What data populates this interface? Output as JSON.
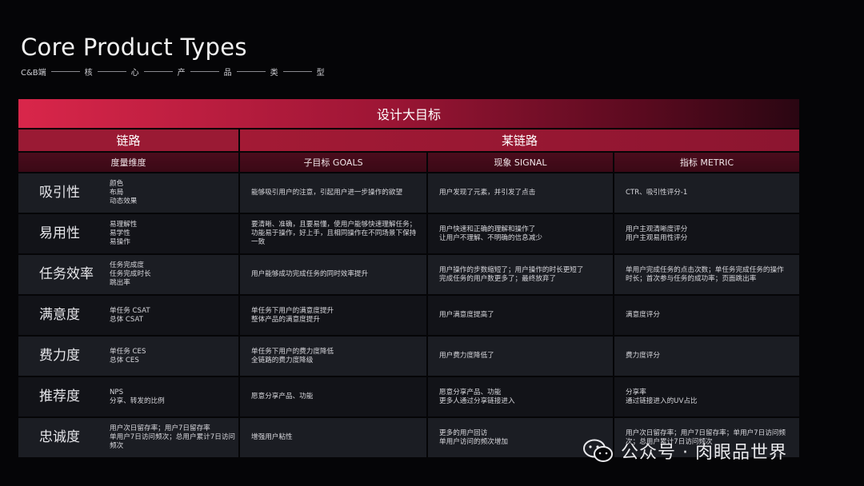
{
  "header": {
    "title": "Core Product Types",
    "subtitle": [
      "C&B端",
      "核",
      "心",
      "产",
      "品",
      "类",
      "型"
    ]
  },
  "table": {
    "banner": "设计大目标",
    "header1": {
      "left": "链路",
      "right": "某链路"
    },
    "header2": [
      "度量维度",
      "子目标 GOALS",
      "现象 SIGNAL",
      "指标 METRIC"
    ],
    "rows": [
      {
        "dimension": "吸引性",
        "subs": [
          "颜色",
          "布局",
          "动态效果"
        ],
        "goals": "能够吸引用户的注意，引起用户进一步操作的欲望",
        "signal": "用户发现了元素，并引发了点击",
        "metric": "CTR、吸引性评分-1"
      },
      {
        "dimension": "易用性",
        "subs": [
          "易理解性",
          "易学性",
          "易操作"
        ],
        "goals": "要清晰、准确，且要易懂，使用户能够快速理解任务；\n功能易于操作，好上手，且相同操作在不同场景下保持一致",
        "signal": "用户快速和正确的理解和操作了\n让用户不理解、不明确的信息减少",
        "metric": "用户主观清晰度评分\n用户主观易用性评分"
      },
      {
        "dimension": "任务效率",
        "subs": [
          "任务完成度",
          "任务完成时长",
          "跳出率"
        ],
        "goals": "用户能够成功完成任务的同时效率提升",
        "signal": "用户操作的步数缩短了；用户操作的时长更短了\n完成任务的用户数更多了；最终放弃了",
        "metric": "单用户完成任务的点击次数；单任务完成任务的操作时长；首次参与任务的成功率；页面跳出率"
      },
      {
        "dimension": "满意度",
        "subs": [
          "单任务 CSAT",
          "总体 CSAT"
        ],
        "goals": "单任务下用户的满意度提升\n整体产品的满意度提升",
        "signal": "用户满意度提高了",
        "metric": "满意度评分"
      },
      {
        "dimension": "费力度",
        "subs": [
          "单任务 CES",
          "总体 CES"
        ],
        "goals": "单任务下用户的费力度降低\n全链路的费力度降级",
        "signal": "用户费力度降低了",
        "metric": "费力度评分"
      },
      {
        "dimension": "推荐度",
        "subs": [
          "NPS",
          "分享、转发的比例"
        ],
        "goals": "愿意分享产品、功能",
        "signal": "愿意分享产品、功能\n更多人通过分享链接进入",
        "metric": "分享率\n通过链接进入的UV占比"
      },
      {
        "dimension": "忠诚度",
        "subs": [
          "用户次日留存率；用户7日留存率",
          "单用户7日访问频次；总用户累计7日访问频次"
        ],
        "goals": "增强用户粘性",
        "signal": "更多的用户回访\n单用户访问的频次增加",
        "metric": "用户次日留存率；用户7日留存率；单用户7日访问频次；总用户累计7日访问频次"
      }
    ]
  },
  "watermark": {
    "text": "公众号 · 肉眼品世界",
    "icon": "wechat-icon"
  }
}
